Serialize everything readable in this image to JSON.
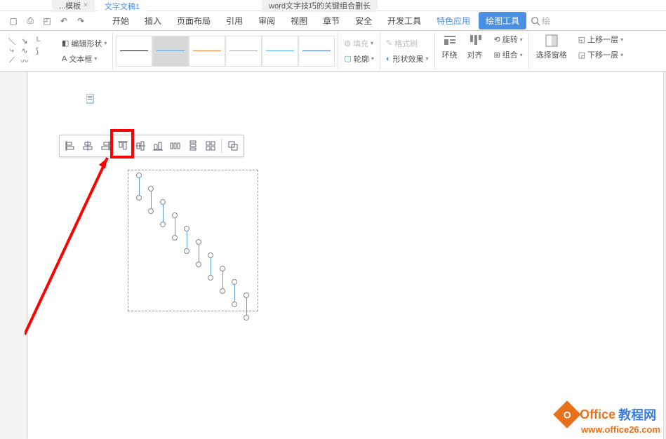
{
  "tabs": {
    "tab1_label": "...模板",
    "tab2_label": "文字文稿1",
    "tab3_label": "word文字技巧的关键组合删长"
  },
  "ribbon_tabs": {
    "start": "开始",
    "insert": "插入",
    "page_layout": "页面布局",
    "references": "引用",
    "review": "审阅",
    "view": "视图",
    "chapter": "章节",
    "security": "安全",
    "developer": "开发工具",
    "special": "特色应用",
    "drawing_tools": "绘图工具",
    "search_placeholder": "绘"
  },
  "ribbon": {
    "edit_shape": "编辑形状",
    "text_box": "文本框",
    "fill": "填充",
    "outline": "轮廓",
    "format_painter": "格式刷",
    "shape_effects": "形状效果",
    "wrap": "环绕",
    "align": "对齐",
    "rotate": "旋转",
    "group": "组合",
    "selection_pane": "选择窗格",
    "bring_forward": "上移一层",
    "send_backward": "下移一层"
  },
  "watermark": {
    "brand1": "Office",
    "brand2": "教程网",
    "url": "www.office26.com"
  }
}
